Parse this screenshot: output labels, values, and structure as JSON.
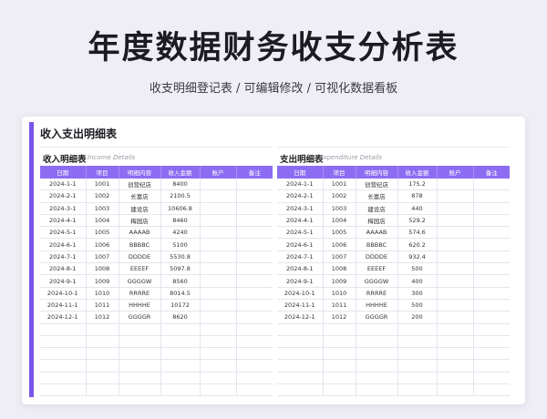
{
  "page": {
    "title": "年度数据财务收支分析表",
    "subtitle": "收支明细登记表 /  可编辑修改  /  可视化数据看板"
  },
  "card": {
    "title": "收入支出明细表"
  },
  "income": {
    "title": "收入明细表",
    "subtitle": "Income Details",
    "headers": [
      "日期",
      "项目",
      "明细内容",
      "收入金额",
      "账户",
      "备注"
    ],
    "rows": [
      [
        "2024-1-1",
        "1001",
        "创营纪店",
        "8400",
        "",
        ""
      ],
      [
        "2024-2-1",
        "1002",
        "长富店",
        "2100.5",
        "",
        ""
      ],
      [
        "2024-3-1",
        "1003",
        "建设店",
        "10606.8",
        "",
        ""
      ],
      [
        "2024-4-1",
        "1004",
        "梅园店",
        "8460",
        "",
        ""
      ],
      [
        "2024-5-1",
        "1005",
        "AAAAB",
        "4240",
        "",
        ""
      ],
      [
        "2024-6-1",
        "1006",
        "BBBBC",
        "5100",
        "",
        ""
      ],
      [
        "2024-7-1",
        "1007",
        "DDDDE",
        "5530.8",
        "",
        ""
      ],
      [
        "2024-8-1",
        "1008",
        "EEEEF",
        "5097.8",
        "",
        ""
      ],
      [
        "2024-9-1",
        "1009",
        "GGGGW",
        "8560",
        "",
        ""
      ],
      [
        "2024-10-1",
        "1010",
        "RRRRE",
        "8014.5",
        "",
        ""
      ],
      [
        "2024-11-1",
        "1011",
        "HHHHE",
        "10172",
        "",
        ""
      ],
      [
        "2024-12-1",
        "1012",
        "GGGGR",
        "8620",
        "",
        ""
      ]
    ]
  },
  "expense": {
    "title": "支出明细表",
    "subtitle": "Expenditure Details",
    "headers": [
      "日期",
      "项目",
      "明细内容",
      "收入金额",
      "账户",
      "备注"
    ],
    "rows": [
      [
        "2024-1-1",
        "1001",
        "创营纪店",
        "175.2",
        "",
        ""
      ],
      [
        "2024-2-1",
        "1002",
        "长富店",
        "878",
        "",
        ""
      ],
      [
        "2024-3-1",
        "1003",
        "建设店",
        "440",
        "",
        ""
      ],
      [
        "2024-4-1",
        "1004",
        "梅园店",
        "529.2",
        "",
        ""
      ],
      [
        "2024-5-1",
        "1005",
        "AAAAB",
        "574.6",
        "",
        ""
      ],
      [
        "2024-6-1",
        "1006",
        "BBBBC",
        "620.2",
        "",
        ""
      ],
      [
        "2024-7-1",
        "1007",
        "DDDDE",
        "932.4",
        "",
        ""
      ],
      [
        "2024-8-1",
        "1008",
        "EEEEF",
        "500",
        "",
        ""
      ],
      [
        "2024-9-1",
        "1009",
        "GGGGW",
        "400",
        "",
        ""
      ],
      [
        "2024-10-1",
        "1010",
        "RRRRE",
        "300",
        "",
        ""
      ],
      [
        "2024-11-1",
        "1011",
        "HHHHE",
        "500",
        "",
        ""
      ],
      [
        "2024-12-1",
        "1012",
        "GGGGR",
        "200",
        "",
        ""
      ]
    ]
  },
  "colors": {
    "accent": "#7a55ea",
    "header_bg": "#8c6df2",
    "page_bg": "#efeef4"
  }
}
